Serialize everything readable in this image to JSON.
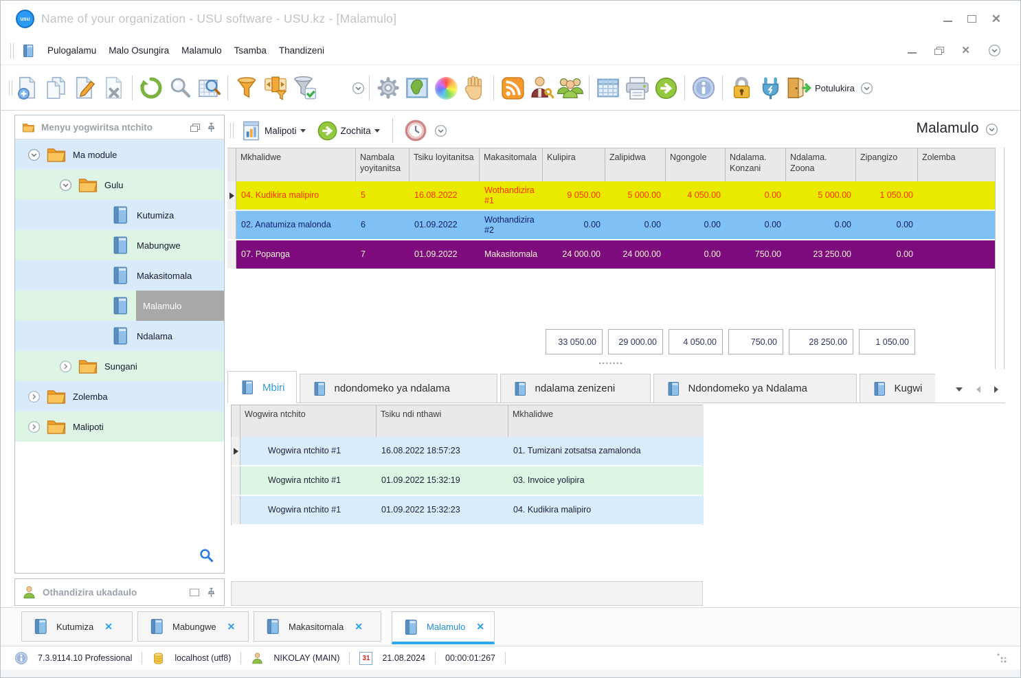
{
  "window": {
    "title": "Name of your organization - USU software - USU.kz - [Malamulo]",
    "logo": "usu"
  },
  "menu": {
    "items": [
      "Pulogalamu",
      "Malo Osungira",
      "Malamulo",
      "Tsamba",
      "Thandizeni"
    ]
  },
  "toolbar": {
    "icons": [
      "new-record",
      "copy-record",
      "edit-record",
      "delete-record",
      "refresh",
      "search",
      "search-in-table",
      "filter",
      "filter-range",
      "filter-confirm",
      "settings",
      "map",
      "colors",
      "pan",
      "subscriptions",
      "user-permissions",
      "users",
      "table-view",
      "print",
      "go-next",
      "info",
      "lock",
      "plug",
      "exit-door"
    ],
    "exit_label": "Potulukira"
  },
  "sidebar": {
    "header": "Menyu yogwiritsa ntchito",
    "tree": [
      {
        "label": "Ma module"
      },
      {
        "label": "Gulu"
      },
      {
        "label": "Kutumiza"
      },
      {
        "label": "Mabungwe"
      },
      {
        "label": "Makasitomala"
      },
      {
        "label": "Malamulo"
      },
      {
        "label": "Ndalama"
      },
      {
        "label": "Sungani"
      },
      {
        "label": "Zolemba"
      },
      {
        "label": "Malipoti"
      }
    ],
    "helper_header": "Othandizira ukadaulo"
  },
  "main": {
    "report_button": "Malipoti",
    "actions_button": "Zochita",
    "title": "Malamulo",
    "table": {
      "columns": [
        "Mkhalidwe",
        "Nambala yoyitanitsa",
        "Tsiku loyitanitsa",
        "Makasitomala",
        "Kulipira",
        "Zalipidwa",
        "Ngongole",
        "Ndalama. Konzani",
        "Ndalama. Zoona",
        "Zipangizo",
        "Zolemba"
      ],
      "rows": [
        {
          "status": "yellow",
          "cells": [
            "04. Kudikira malipiro",
            "5",
            "16.08.2022",
            "Wothandizira #1",
            "9 050.00",
            "5 000.00",
            "4 050.00",
            "0.00",
            "5 000.00",
            "1 050.00",
            ""
          ]
        },
        {
          "status": "blue",
          "cells": [
            "02. Anatumiza malonda",
            "6",
            "01.09.2022",
            "Wothandizira #2",
            "0.00",
            "0.00",
            "0.00",
            "0.00",
            "0.00",
            "0.00",
            ""
          ]
        },
        {
          "status": "purple",
          "cells": [
            "07. Popanga",
            "7",
            "01.09.2022",
            "Makasitomala",
            "24 000.00",
            "24 000.00",
            "0.00",
            "750.00",
            "23 250.00",
            "0.00",
            ""
          ]
        }
      ],
      "totals": [
        "33 050.00",
        "29 000.00",
        "4 050.00",
        "750.00",
        "28 250.00",
        "1 050.00"
      ]
    },
    "detail_tabs": [
      "Mbiri",
      "ndondomeko ya ndalama",
      "ndalama zenizeni",
      "Ndondomeko ya Ndalama",
      "Kugwi"
    ],
    "detail_table": {
      "columns": [
        "Wogwira ntchito",
        "Tsiku ndi nthawi",
        "Mkhalidwe"
      ],
      "rows": [
        [
          "Wogwira ntchito #1",
          "16.08.2022 18:57:23",
          "01. Tumizani zotsatsa zamalonda"
        ],
        [
          "Wogwira ntchito #1",
          "01.09.2022 15:32:19",
          "03. Invoice yolipira"
        ],
        [
          "Wogwira ntchito #1",
          "01.09.2022 15:32:23",
          "04. Kudikira malipiro"
        ]
      ]
    }
  },
  "window_tabs": [
    {
      "label": "Kutumiza"
    },
    {
      "label": "Mabungwe"
    },
    {
      "label": "Makasitomala"
    },
    {
      "label": "Malamulo"
    }
  ],
  "statusbar": {
    "version": "7.3.9114.10 Professional",
    "database": "localhost (utf8)",
    "user": "NIKOLAY (MAIN)",
    "calendar_day": "31",
    "date": "21.08.2024",
    "timer": "00:00:01:267"
  },
  "colors": {
    "row_yellow": "#e9ea00",
    "row_yellow_text": "#ff2e00",
    "row_blue": "#80c1f5",
    "row_purple": "#7d0b7d",
    "stripe_blue": "#d9ebfa",
    "stripe_green": "#def5e5",
    "accent_blue": "#29aaf0"
  }
}
